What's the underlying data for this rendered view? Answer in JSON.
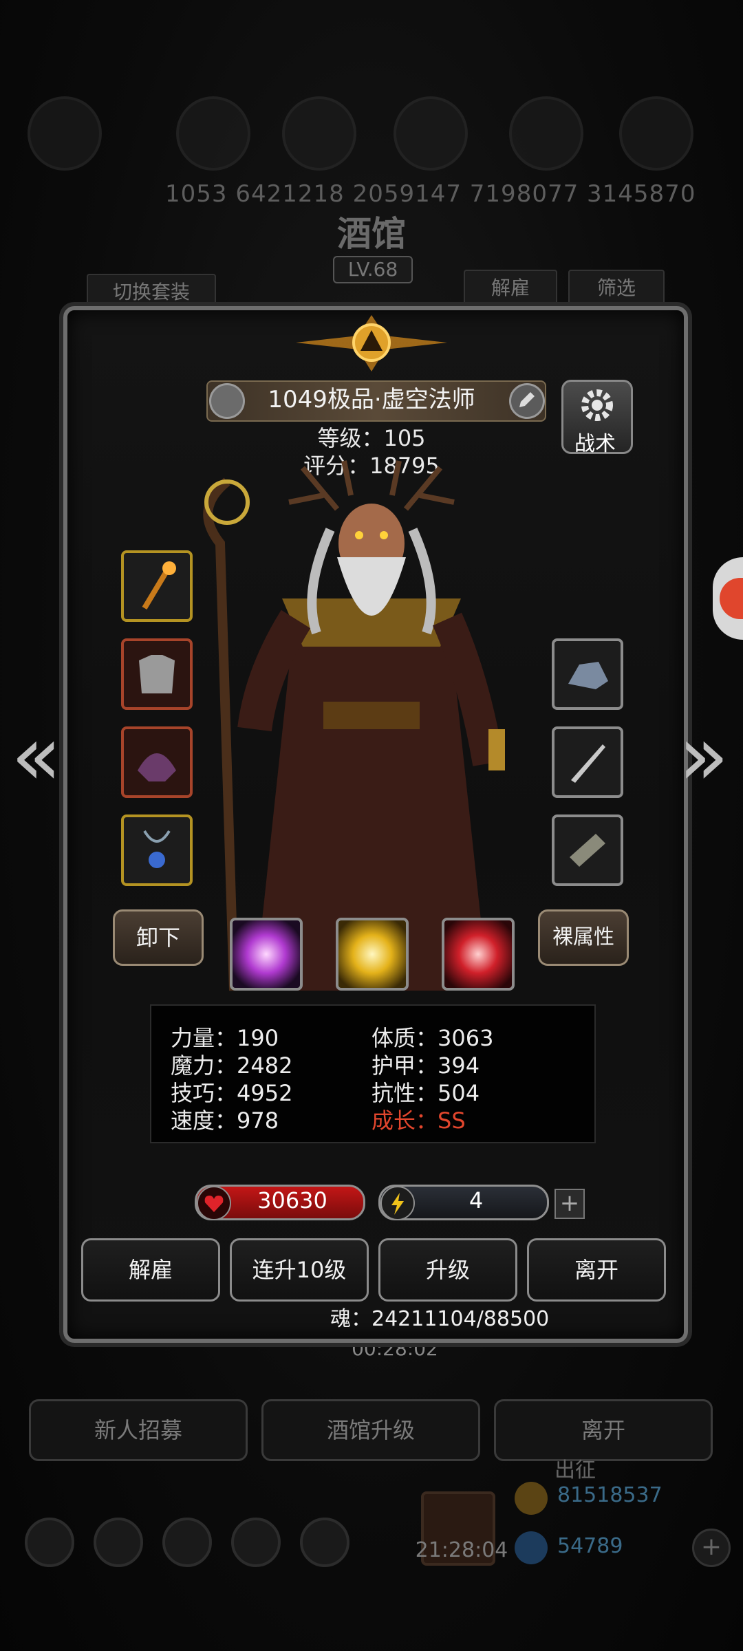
{
  "background": {
    "resource_numbers": "1053  6421218  2059147  7198077  3145870",
    "tavern_title": "酒馆",
    "tavern_level": "LV.68",
    "switch_set_button": "切换套装",
    "dismiss_button": "解雇",
    "filter_button": "筛选",
    "bottom_buttons": [
      "新人招募",
      "酒馆升级",
      "离开"
    ],
    "timer": "00:28:02",
    "expedition_label": "出征",
    "gold_amount": "81518537",
    "gem_amount": "54789",
    "clock": "21:28:04"
  },
  "hero": {
    "name": "1049极品·虚空法师",
    "level_line": "等级：105",
    "score_line": "评分：18795",
    "tactics_label": "战术",
    "unequip_button": "卸下",
    "raw_attr_button": "裸属性"
  },
  "equipment": {
    "left": [
      "staff-icon",
      "armor-icon",
      "helmet-icon",
      "amulet-icon"
    ],
    "right": [
      "gem-ore-icon",
      "dagger-icon",
      "bracer-icon"
    ]
  },
  "skills": [
    "purple-slash-skill",
    "golden-burst-skill",
    "red-slash-skill"
  ],
  "attributes": {
    "strength": "力量：190",
    "constitution": "体质：3063",
    "magic": "魔力：2482",
    "armor": "护甲：394",
    "skill": "技巧：4952",
    "resistance": "抗性：504",
    "speed": "速度：978",
    "growth": "成长：SS"
  },
  "bars": {
    "hp": "30630",
    "energy": "4",
    "plus": "+"
  },
  "actions": [
    "解雇",
    "连升10级",
    "升级",
    "离开"
  ],
  "soul": "魂：24211104/88500",
  "colors": {
    "growth_red": "#e2462d",
    "hp_red": "#c31616",
    "gold_frame": "#b49322"
  }
}
